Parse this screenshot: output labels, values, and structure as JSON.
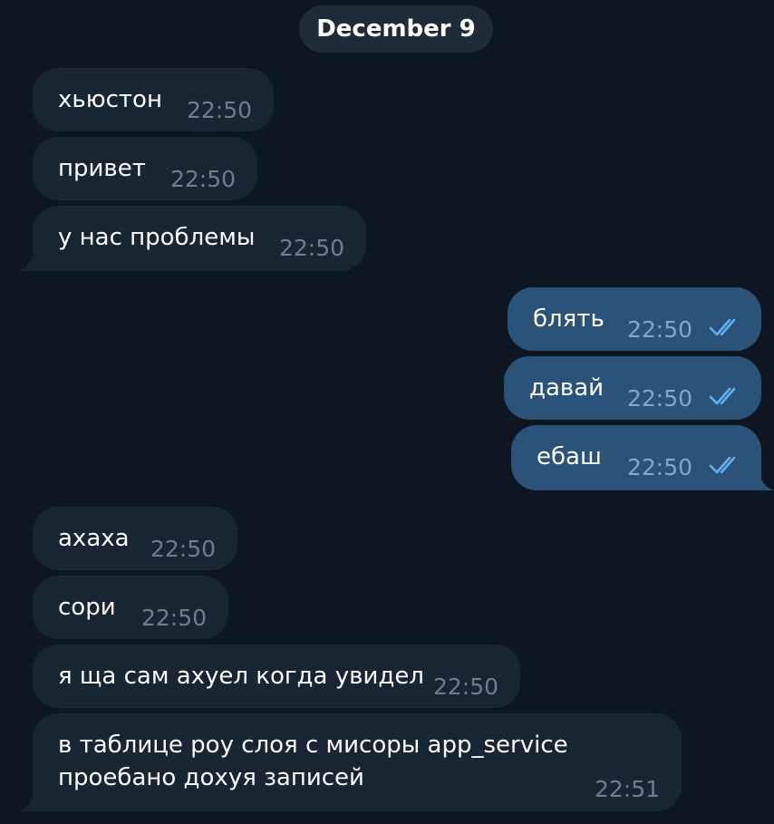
{
  "date_label": "December 9",
  "messages": [
    {
      "direction": "in",
      "text": "хьюстон",
      "time": "22:50"
    },
    {
      "direction": "in",
      "text": "привет",
      "time": "22:50"
    },
    {
      "direction": "in",
      "text": "у нас проблемы",
      "time": "22:50"
    },
    {
      "direction": "out",
      "text": "блять",
      "time": "22:50",
      "status": "read"
    },
    {
      "direction": "out",
      "text": "давай",
      "time": "22:50",
      "status": "read"
    },
    {
      "direction": "out",
      "text": "ебаш",
      "time": "22:50",
      "status": "read"
    },
    {
      "direction": "in",
      "text": "ахаха",
      "time": "22:50"
    },
    {
      "direction": "in",
      "text": "сори",
      "time": "22:50"
    },
    {
      "direction": "in",
      "text": "я ща сам ахуел когда увидел",
      "time": "22:50"
    },
    {
      "direction": "in",
      "text_lines": [
        "в таблице роу слоя с мисоры app_service",
        "проебано дохуя записей"
      ],
      "time": "22:51"
    }
  ],
  "colors": {
    "background": "#0e1621",
    "incoming_bubble": "#182533",
    "outgoing_bubble": "#2b5278",
    "incoming_time": "#6d7f8f",
    "outgoing_time": "#7da8d3",
    "read_check": "#5fb2f0"
  },
  "icons": {
    "read_status": "double-check-icon"
  }
}
